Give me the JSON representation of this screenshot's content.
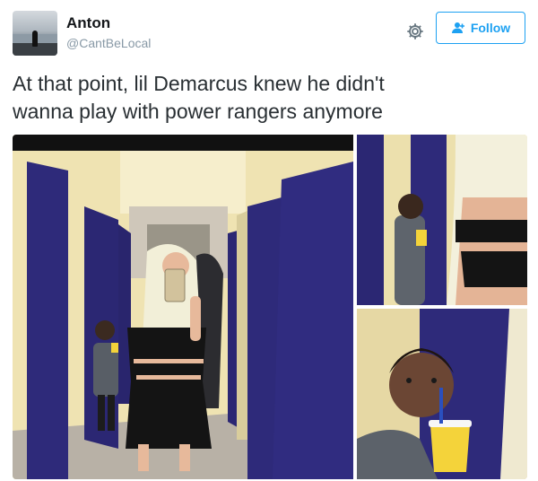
{
  "user": {
    "name": "Anton",
    "handle": "@CantBeLocal"
  },
  "actions": {
    "settings_icon": "gear-icon",
    "follow_label": "Follow",
    "follow_icon": "add-user-icon"
  },
  "tweet": {
    "text_line1": "At that point, lil Demarcus knew he didn't",
    "text_line2": "wanna play with power rangers anymore"
  },
  "colors": {
    "accent": "#1da1f2",
    "handle": "#8899a6",
    "text": "#292f33"
  }
}
